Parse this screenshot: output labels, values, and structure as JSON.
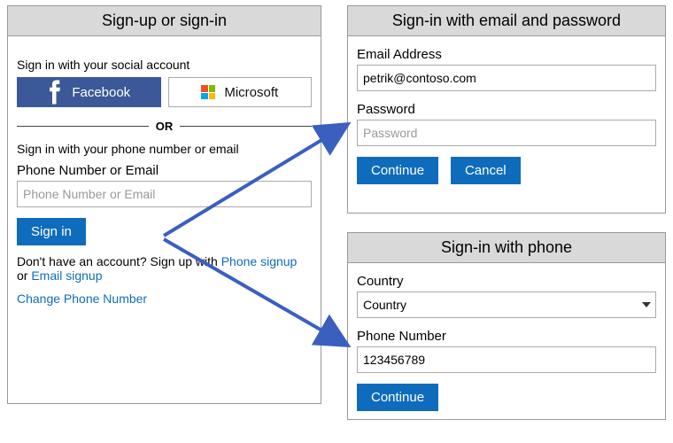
{
  "left": {
    "title": "Sign-up or sign-in",
    "social_heading": "Sign in with your social account",
    "facebook_label": "Facebook",
    "microsoft_label": "Microsoft",
    "or_text": "OR",
    "phone_email_heading": "Sign in with your phone number or email",
    "phone_email_label": "Phone Number or Email",
    "phone_email_placeholder": "Phone Number or Email",
    "signin_label": "Sign in",
    "no_account_prefix": "Don't have an account? Sign up with ",
    "phone_signup_link": "Phone signup",
    "or_word": "or ",
    "email_signup_link": "Email signup",
    "change_phone_link": "Change Phone Number"
  },
  "email": {
    "title": "Sign-in with email and password",
    "email_label": "Email Address",
    "email_value": "petrik@contoso.com",
    "password_label": "Password",
    "password_placeholder": "Password",
    "continue_label": "Continue",
    "cancel_label": "Cancel"
  },
  "phone": {
    "title": "Sign-in with phone",
    "country_label": "Country",
    "country_value": "Country",
    "phone_label": "Phone Number",
    "phone_value": "123456789",
    "continue_label": "Continue"
  },
  "colors": {
    "primary": "#0f6cbd",
    "facebook": "#3b5998",
    "arrow": "#3a5fbf"
  }
}
